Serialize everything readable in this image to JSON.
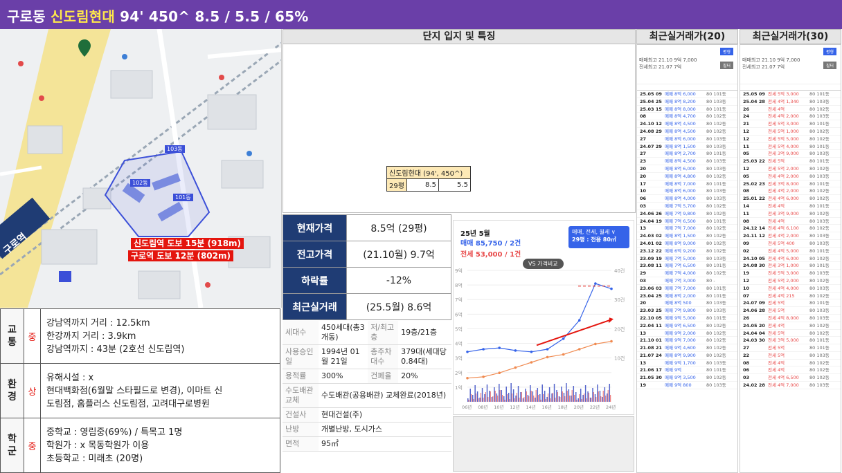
{
  "header": {
    "prefix": "구로동 ",
    "name": "신도림현대",
    "specs": " 94' 450^ 8.5 / 5.5 / 65%"
  },
  "map": {
    "station_label": "구로역",
    "walk1": "신도림역 도보 15분 (918m)",
    "walk2": "구로역 도보 12분 (802m)",
    "bldg1": "103동",
    "bldg2": "101동",
    "bldg3": "102동"
  },
  "info": [
    {
      "cat": "교\n통",
      "grade": "중",
      "lines": [
        "강남역까지 거리 : 12.5km",
        "한강까지 거리 : 3.9km",
        "강남역까지 : 43분 (2호선 신도림역)"
      ]
    },
    {
      "cat": "환\n경",
      "grade": "상",
      "lines": [
        "유해시설 : x",
        "현대백화점(6월말 스타필드로 변경), 이마트 신",
        "도림점, 홈플러스 신도림점, 고려대구로병원"
      ]
    },
    {
      "cat": "학\n군",
      "grade": "중",
      "lines": [
        "중학교 : 영림중(69%) / 특목고 1명",
        "학원가 : x 목동학원가 이용",
        "초등학교 : 미래초 (20명)"
      ]
    }
  ],
  "section": {
    "title": "단지 입지 및 특징"
  },
  "mini_table": {
    "title": "신도림현대 (94', 450^)",
    "size": "29평",
    "sale": "8.5",
    "jeonse": "5.5"
  },
  "price": [
    {
      "k": "현재가격",
      "v": "8.5억 (29평)"
    },
    {
      "k": "전고가격",
      "v": "(21.10월) 9.7억"
    },
    {
      "k": "하락률",
      "v": "-12%"
    },
    {
      "k": "최근실거래",
      "v": "(25.5월) 8.6억"
    }
  ],
  "spec": [
    {
      "k": "세대수",
      "v": "450세대(총3개동)",
      "k2": "저/최고층",
      "v2": "19층/21층"
    },
    {
      "k": "사용승인일",
      "v": "1994년 01월 21일",
      "k2": "총주차대수",
      "v2": "379대(세대당 0.84대)"
    },
    {
      "k": "용적률",
      "v": "300%",
      "k2": "건폐율",
      "v2": "20%"
    },
    {
      "k": "수도배관교체",
      "v": "수도배관(공용배관) 교체완료(2018년)",
      "k2": "",
      "v2": ""
    },
    {
      "k": "건설사",
      "v": "현대건설(주)",
      "k2": "",
      "v2": ""
    },
    {
      "k": "난방",
      "v": "개별난방, 도시가스",
      "k2": "",
      "v2": ""
    },
    {
      "k": "면적",
      "v": "95㎡",
      "k2": "",
      "v2": ""
    }
  ],
  "chart": {
    "month": "25년 5월",
    "sale": "매매 85,750 / 2건",
    "jeonse": "전세 53,000 / 1건",
    "filter": "매매, 전세, 월세 ∨",
    "size": "29평 : 전용 80㎡",
    "compare": "VS 가격비교",
    "y_left": [
      "9억",
      "8억",
      "7억",
      "6억",
      "5억",
      "4억",
      "3억",
      "2억",
      "1억"
    ],
    "y_right": [
      "40건",
      "30건",
      "20건",
      "10건"
    ],
    "x": [
      "06년",
      "08년",
      "10년",
      "12년",
      "14년",
      "16년",
      "18년",
      "20년",
      "22년",
      "24년"
    ]
  },
  "chart_data": {
    "type": "line",
    "x": [
      "06년",
      "08년",
      "10년",
      "12년",
      "14년",
      "16년",
      "18년",
      "20년",
      "22년",
      "24년"
    ],
    "series": [
      {
        "name": "매매",
        "values": [
          3.8,
          4.0,
          4.1,
          3.9,
          3.8,
          4.0,
          4.8,
          6.2,
          9.0,
          8.6
        ]
      },
      {
        "name": "전세",
        "values": [
          1.8,
          1.9,
          2.2,
          2.6,
          3.0,
          3.4,
          3.6,
          4.0,
          4.4,
          4.6
        ]
      }
    ],
    "ylim": [
      0,
      10
    ]
  },
  "deals": [
    {
      "title": "최근실거래가(20)",
      "top1": "매매최고 21.10 9억 7,000",
      "top2": "전세최고 21.07 7억",
      "btn1": "평형",
      "btn2": "필터",
      "rows": [
        [
          "25.05 09",
          "매매 8억 6,000",
          "80 101동"
        ],
        [
          "25.04 25",
          "매매 8억 8,200",
          "80 103동"
        ],
        [
          "25.03 15",
          "매매 8억 8,000",
          "80 101동"
        ],
        [
          "08",
          "매매 8억 4,700",
          "80 102동"
        ],
        [
          "24.10 12",
          "매매 8억 4,500",
          "80 102동"
        ],
        [
          "24.08 29",
          "매매 8억 4,500",
          "80 102동"
        ],
        [
          "27",
          "매매 8억 6,000",
          "80 103동"
        ],
        [
          "24.07 29",
          "매매 8억 1,500",
          "80 103동"
        ],
        [
          "27",
          "매매 8억 2,700",
          "80 101동"
        ],
        [
          "23",
          "매매 8억 4,500",
          "80 103동"
        ],
        [
          "20",
          "매매 8억 6,000",
          "80 103동"
        ],
        [
          "20",
          "매매 8억 4,800",
          "80 102동"
        ],
        [
          "17",
          "매매 8억 7,000",
          "80 101동"
        ],
        [
          "10",
          "매매 8억 6,000",
          "80 103동"
        ],
        [
          "06",
          "매매 8억 4,000",
          "80 103동"
        ],
        [
          "03",
          "매매 7억 5,700",
          "80 102동"
        ],
        [
          "24.06 26",
          "매매 7억 9,800",
          "80 102동"
        ],
        [
          "24.04 19",
          "매매 7억 6,500",
          "80 101동"
        ],
        [
          "13",
          "매매 7억 7,000",
          "80 102동"
        ],
        [
          "24.03 02",
          "매매 8억 1,500",
          "80 102동"
        ],
        [
          "24.01 02",
          "매매 8억 9,000",
          "80 102동"
        ],
        [
          "23.12 22",
          "매매 6억 9,200",
          "80 102동"
        ],
        [
          "23.09 19",
          "매매 7억 5,000",
          "80 103동"
        ],
        [
          "23.08 11",
          "매매 7억 6,500",
          "80 101동"
        ],
        [
          "29",
          "매매 7억 4,000",
          "80 102동"
        ],
        [
          "03",
          "매매 7억 3,000",
          "80 -"
        ],
        [
          "23.06 03",
          "매매 7억 7,000",
          "80 101동"
        ],
        [
          "23.04 25",
          "매매 8억 2,000",
          "80 101동"
        ],
        [
          "20",
          "매매 8억 500",
          "80 103동"
        ],
        [
          "23.03 25",
          "매매 7억 9,800",
          "80 103동"
        ],
        [
          "22.10 05",
          "매매 9억 5,000",
          "80 101동"
        ],
        [
          "22.04 11",
          "매매 9억 6,500",
          "80 102동"
        ],
        [
          "13",
          "매매 9억 2,000",
          "80 102동"
        ],
        [
          "21.10 01",
          "매매 9억 7,000",
          "80 102동"
        ],
        [
          "21.08 21",
          "매매 9억 4,600",
          "80 102동"
        ],
        [
          "21.07 24",
          "매매 8억 9,900",
          "80 102동"
        ],
        [
          "13",
          "매매 9억 1,700",
          "80 103동"
        ],
        [
          "21.06 17",
          "매매 9억",
          "80 101동"
        ],
        [
          "21.05 30",
          "매매 9억 3,500",
          "80 102동"
        ],
        [
          "19",
          "매매 9억 800",
          "80 103동"
        ]
      ]
    },
    {
      "title": "최근실거래가(30)",
      "top1": "매매최고 21.10 9억 7,000",
      "top2": "전세최고 21.07 7억",
      "btn1": "평형",
      "btn2": "필터",
      "rows": [
        [
          "25.05 09",
          "전세 5억 3,000",
          "80 101동"
        ],
        [
          "25.04 28",
          "전세 4억 1,340",
          "80 103동"
        ],
        [
          "26",
          "전세 4억",
          "80 102동"
        ],
        [
          "24",
          "전세 4억 2,000",
          "80 103동"
        ],
        [
          "21",
          "전세 5억 3,000",
          "80 101동"
        ],
        [
          "12",
          "전세 5억 1,000",
          "80 102동"
        ],
        [
          "12",
          "전세 5억 5,000",
          "80 102동"
        ],
        [
          "11",
          "전세 5억 4,000",
          "80 101동"
        ],
        [
          "05",
          "전세 3억 9,000",
          "80 103동"
        ],
        [
          "25.03 22",
          "전세 5억",
          "80 101동"
        ],
        [
          "12",
          "전세 5억 2,000",
          "80 102동"
        ],
        [
          "05",
          "전세 4억 2,000",
          "80 103동"
        ],
        [
          "25.02 23",
          "전세 3억 8,000",
          "80 101동"
        ],
        [
          "08",
          "전세 4억 2,000",
          "80 102동"
        ],
        [
          "25.01 22",
          "전세 4억 6,000",
          "80 102동"
        ],
        [
          "14",
          "전세 4억",
          "80 101동"
        ],
        [
          "11",
          "전세 3억 9,000",
          "80 102동"
        ],
        [
          "08",
          "전세 4억",
          "80 103동"
        ],
        [
          "24.12 14",
          "전세 4억 6,100",
          "80 102동"
        ],
        [
          "24.11 12",
          "전세 4억 2,000",
          "80 103동"
        ],
        [
          "09",
          "전세 5억 400",
          "80 103동"
        ],
        [
          "02",
          "전세 4억 5,000",
          "80 101동"
        ],
        [
          "24.10 05",
          "전세 4억 6,000",
          "80 102동"
        ],
        [
          "24.08 30",
          "전세 3억 1,000",
          "80 101동"
        ],
        [
          "19",
          "전세 5억 3,000",
          "80 103동"
        ],
        [
          "12",
          "전세 5억 2,000",
          "80 102동"
        ],
        [
          "10",
          "전세 4억 4,000",
          "80 103동"
        ],
        [
          "07",
          "전세 4억 215",
          "80 102동"
        ],
        [
          "24.07 09",
          "전세 5억",
          "80 101동"
        ],
        [
          "24.06 28",
          "전세 5억",
          "80 103동"
        ],
        [
          "26",
          "전세 4억 8,000",
          "80 103동"
        ],
        [
          "24.05 20",
          "전세 4억",
          "80 102동"
        ],
        [
          "24.04 04",
          "전세 5억",
          "80 102동"
        ],
        [
          "24.03 30",
          "전세 3억 5,000",
          "80 101동"
        ],
        [
          "27",
          "전세 5억",
          "80 101동"
        ],
        [
          "22",
          "전세 5억",
          "80 103동"
        ],
        [
          "08",
          "전세 4억",
          "80 102동"
        ],
        [
          "06",
          "전세 4억",
          "80 102동"
        ],
        [
          "03",
          "전세 4억 6,500",
          "80 102동"
        ],
        [
          "24.02 28",
          "전세 4억 7,000",
          "80 103동"
        ]
      ]
    }
  ]
}
